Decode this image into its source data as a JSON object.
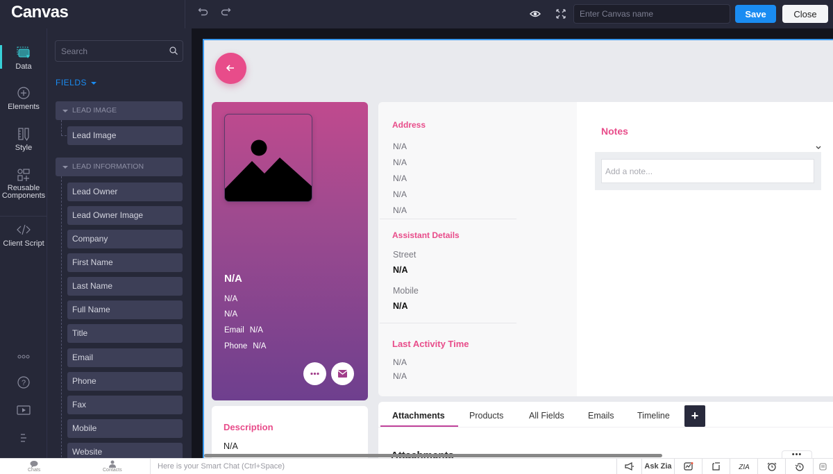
{
  "app": {
    "logo": "Canvas",
    "canvas_name_placeholder": "Enter Canvas name",
    "save_label": "Save",
    "close_label": "Close"
  },
  "rail": {
    "items": [
      {
        "label": "Data",
        "icon": "data-icon",
        "active": true
      },
      {
        "label": "Elements",
        "icon": "plus-circle-icon"
      },
      {
        "label": "Style",
        "icon": "ruler-pencil-icon"
      },
      {
        "label": "Reusable Components",
        "icon": "components-icon"
      },
      {
        "label": "Client Script",
        "icon": "code-icon"
      }
    ],
    "bottom_icons": [
      "more-icon",
      "help-icon",
      "video-icon",
      "menu-icon"
    ]
  },
  "fields_panel": {
    "search_placeholder": "Search",
    "toggle_label": "FIELDS",
    "groups": [
      {
        "label": "LEAD IMAGE",
        "fields": [
          "Lead Image"
        ]
      },
      {
        "label": "LEAD INFORMATION",
        "fields": [
          "Lead Owner",
          "Lead Owner Image",
          "Company",
          "First Name",
          "Last Name",
          "Full Name",
          "Title",
          "Email",
          "Phone",
          "Fax",
          "Mobile",
          "Website"
        ]
      }
    ]
  },
  "profile": {
    "name": "N/A",
    "line1": "N/A",
    "line2": "N/A",
    "email_label": "Email",
    "email_value": "N/A",
    "phone_label": "Phone",
    "phone_value": "N/A",
    "accent_color": "#e84c8a"
  },
  "description": {
    "title": "Description",
    "value": "N/A"
  },
  "address": {
    "title": "Address",
    "lines": [
      "N/A",
      "N/A",
      "N/A",
      "N/A",
      "N/A"
    ]
  },
  "assistant": {
    "title": "Assistant Details",
    "street_label": "Street",
    "street_value": "N/A",
    "mobile_label": "Mobile",
    "mobile_value": "N/A"
  },
  "last_activity": {
    "title": "Last Activity Time",
    "lines": [
      "N/A",
      "N/A"
    ]
  },
  "notes": {
    "title": "Notes",
    "placeholder": "Add a note..."
  },
  "tabs": {
    "items": [
      "Attachments",
      "Products",
      "All Fields",
      "Emails",
      "Timeline"
    ],
    "active": "Attachments",
    "add_label": "+",
    "section_heading": "Attachments",
    "more_label": "•••"
  },
  "bottombar": {
    "chats_label": "Chats",
    "contacts_label": "Contacts",
    "smart_chat_placeholder": "Here is your Smart Chat (Ctrl+Space)",
    "ask_zia_label": "Ask Zia",
    "tools": [
      "announcement-icon",
      "ask-zia",
      "insights-icon",
      "notes-icon",
      "zia-icon",
      "alarm-icon",
      "history-icon",
      "copy-icon"
    ]
  }
}
